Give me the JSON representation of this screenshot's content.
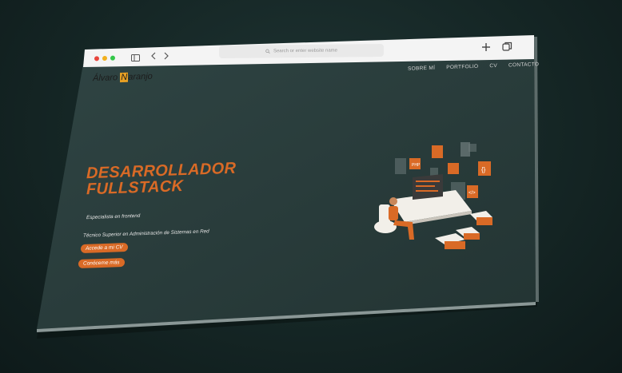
{
  "browser": {
    "url_placeholder": "Search or enter website name",
    "traffic_lights": [
      "#e8453c",
      "#f2b01e",
      "#33c748"
    ]
  },
  "site": {
    "logo_first": "Álvaro ",
    "logo_initial": "N",
    "logo_rest": "aranjo",
    "nav": [
      "SOBRE MÍ",
      "PORTFOLIO",
      "CV",
      "CONTACTO"
    ],
    "hero_line1": "DESARROLLADOR",
    "hero_line2": "FULLSTACK",
    "tagline": "Especialista en frontend",
    "degree": "Técnico Superior en Administración de Sistemas en Red",
    "cv_button": "Accede a mi CV",
    "about_button": "Conóceme más"
  },
  "colors": {
    "accent": "#d96a26",
    "page_bg": "#2a3b3a",
    "chrome": "#f4f4f4"
  }
}
